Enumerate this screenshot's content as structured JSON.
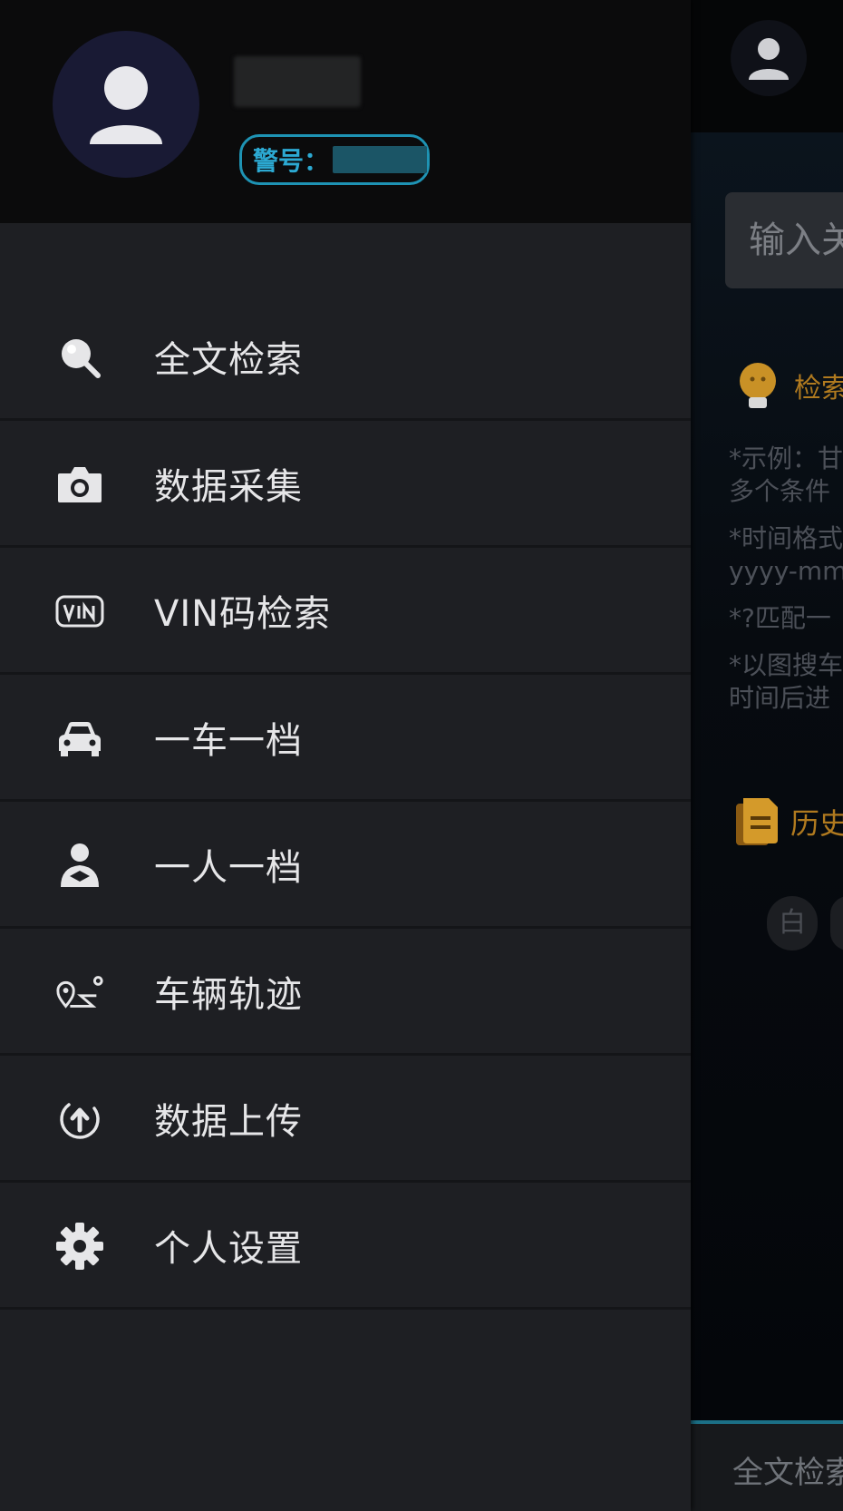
{
  "background_app": {
    "search_placeholder": "输入关",
    "tips_title": "检索",
    "tips_lines": [
      "*示例：甘",
      "多个条件",
      "*时间格式",
      "yyyy-mm",
      "*?匹配一",
      "*以图搜车",
      "时间后进"
    ],
    "history_title": "历史",
    "history_chip": "白",
    "bottom_tab_label": "全文检索"
  },
  "drawer": {
    "badge_label": "警号：",
    "menu": [
      {
        "label": "全文检索",
        "icon": "search-icon"
      },
      {
        "label": "数据采集",
        "icon": "camera-icon"
      },
      {
        "label": "VIN码检索",
        "icon": "vin-icon"
      },
      {
        "label": "一车一档",
        "icon": "car-icon"
      },
      {
        "label": "一人一档",
        "icon": "person-icon"
      },
      {
        "label": "车辆轨迹",
        "icon": "route-icon"
      },
      {
        "label": "数据上传",
        "icon": "upload-icon"
      },
      {
        "label": "个人设置",
        "icon": "gear-icon"
      }
    ]
  },
  "colors": {
    "drawer_bg": "#1e1f23",
    "header_bg": "#0b0b0c",
    "accent": "#1e93b4",
    "orange": "#b07a1f"
  }
}
